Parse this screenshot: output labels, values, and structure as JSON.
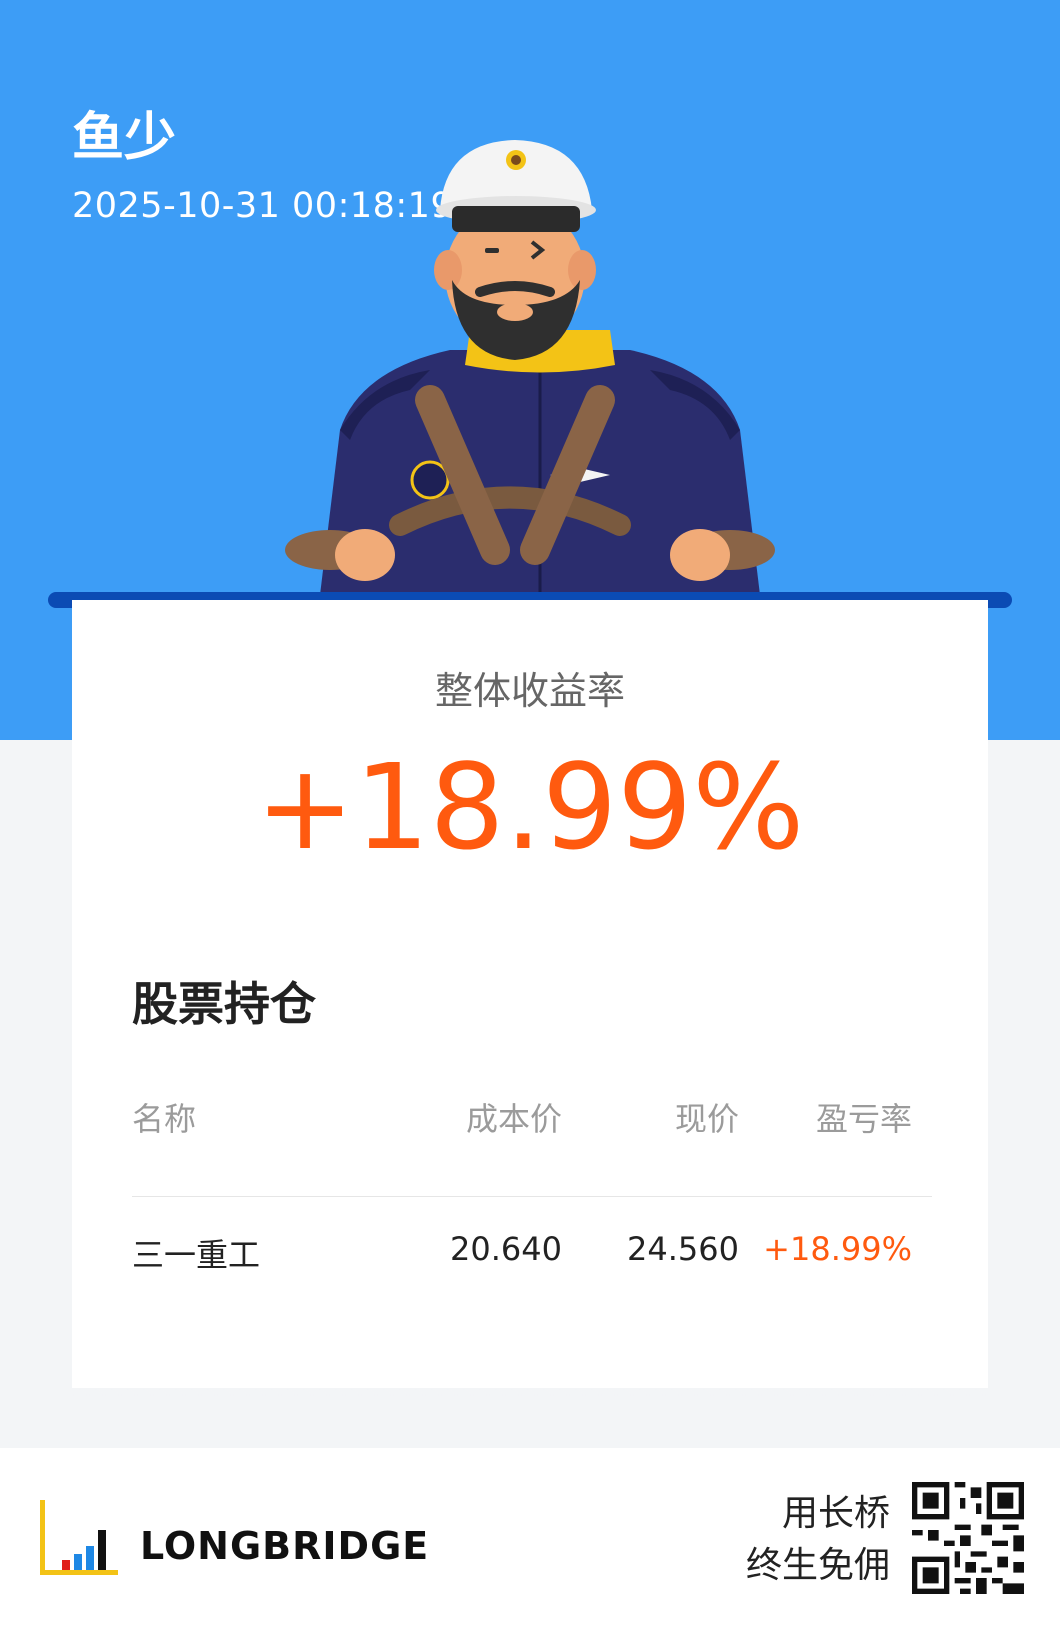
{
  "header": {
    "user_name": "鱼少",
    "timestamp": "2025-10-31 00:18:19"
  },
  "summary": {
    "label": "整体收益率",
    "value": "+18.99%"
  },
  "holdings": {
    "title": "股票持仓",
    "columns": [
      "名称",
      "成本价",
      "现价",
      "盈亏率"
    ],
    "rows": [
      {
        "name": "三一重工",
        "cost": "20.640",
        "price": "24.560",
        "pl": "+18.99%"
      }
    ]
  },
  "footer": {
    "brand": "LONGBRIDGE",
    "slogan_line1": "用长桥",
    "slogan_line2": "终生免佣"
  },
  "colors": {
    "brand_blue": "#3d9df6",
    "accent_bar": "#0b4bb4",
    "profit": "#ff5a0f"
  }
}
